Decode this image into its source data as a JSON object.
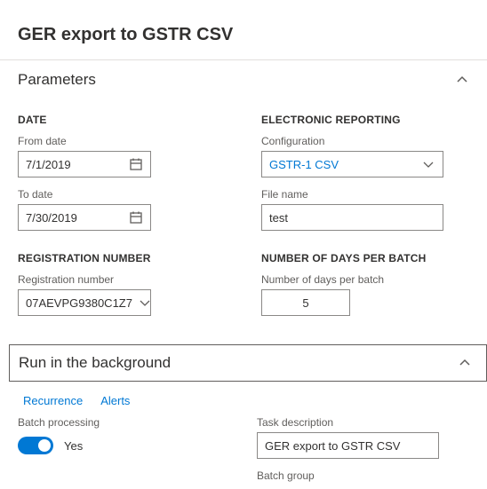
{
  "header": {
    "title": "GER export to GSTR CSV"
  },
  "parameters": {
    "title": "Parameters",
    "date_group": "DATE",
    "from_date_label": "From date",
    "from_date_value": "7/1/2019",
    "to_date_label": "To date",
    "to_date_value": "7/30/2019",
    "reg_group": "REGISTRATION NUMBER",
    "reg_label": "Registration number",
    "reg_value": "07AEVPG9380C1Z7",
    "er_group": "ELECTRONIC REPORTING",
    "config_label": "Configuration",
    "config_value": "GSTR-1 CSV",
    "filename_label": "File name",
    "filename_value": "test",
    "days_group": "NUMBER OF DAYS PER BATCH",
    "days_label": "Number of days per batch",
    "days_value": "5"
  },
  "background": {
    "title": "Run in the background",
    "recurrence": "Recurrence",
    "alerts": "Alerts",
    "batch_proc_label": "Batch processing",
    "batch_proc_state": "Yes",
    "task_desc_label": "Task description",
    "task_desc_value": "GER export to GSTR CSV",
    "batch_group_label": "Batch group"
  }
}
